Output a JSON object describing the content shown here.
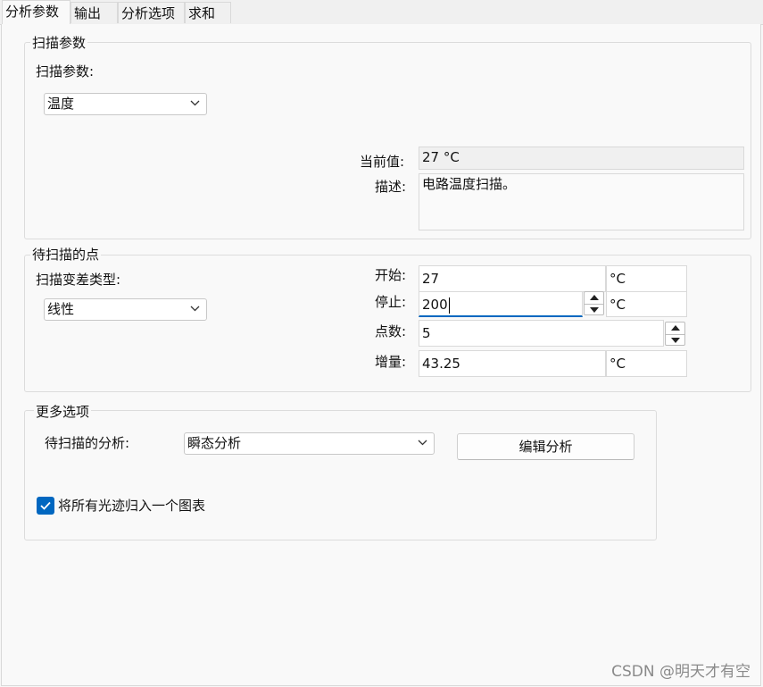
{
  "tabs": [
    {
      "label": "分析参数",
      "active": true
    },
    {
      "label": "输出",
      "active": false
    },
    {
      "label": "分析选项",
      "active": false
    },
    {
      "label": "求和",
      "active": false
    }
  ],
  "scan_params": {
    "group_title": "扫描参数",
    "param_label": "扫描参数:",
    "param_value": "温度",
    "current_value_label": "当前值:",
    "current_value": "27 °C",
    "description_label": "描述:",
    "description": "电路温度扫描。"
  },
  "points": {
    "group_title": "待扫描的点",
    "variation_label": "扫描变差类型:",
    "variation_value": "线性",
    "start_label": "开始:",
    "start_value": "27",
    "start_unit": "°C",
    "stop_label": "停止:",
    "stop_value": "200",
    "stop_unit": "°C",
    "count_label": "点数:",
    "count_value": "5",
    "increment_label": "增量:",
    "increment_value": "43.25",
    "increment_unit": "°C"
  },
  "more": {
    "group_title": "更多选项",
    "analysis_label": "待扫描的分析:",
    "analysis_value": "瞬态分析",
    "edit_button": "编辑分析",
    "checkbox_label": "将所有光迹归入一个图表",
    "checkbox_checked": true
  },
  "watermark": "CSDN @明天才有空",
  "colors": {
    "accent": "#0067c0"
  }
}
